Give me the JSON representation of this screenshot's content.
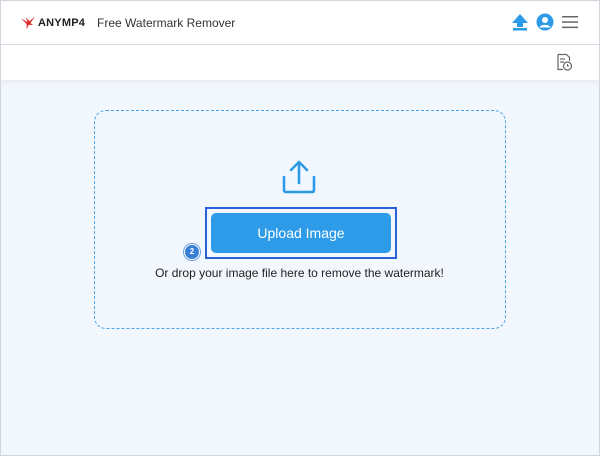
{
  "header": {
    "brand": "ANYMP4",
    "title": "Free Watermark Remover"
  },
  "icons": {
    "logo": "bird-logo-icon",
    "upload_top": "upload-arrow-icon",
    "account": "user-icon",
    "menu": "hamburger-menu-icon",
    "history": "history-icon",
    "dropzone_upload": "upload-icon"
  },
  "colors": {
    "accent": "#2e9be9",
    "highlight_border": "#2b5fd8",
    "dropzone_border": "#4aa3e8",
    "logo_red": "#e02a2a",
    "background": "#f2f7fd"
  },
  "dropzone": {
    "button_label": "Upload Image",
    "step_badge": "2",
    "hint": "Or drop your image file here to remove the watermark!"
  }
}
